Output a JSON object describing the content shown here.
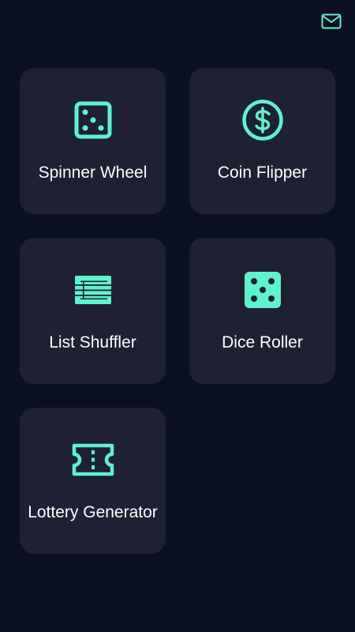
{
  "header": {
    "mail_icon": "mail-icon"
  },
  "colors": {
    "background": "#0b1120",
    "card": "#1d2133",
    "accent": "#5ef2cf",
    "text": "#ffffff"
  },
  "tools": [
    {
      "label": "Spinner Wheel",
      "icon": "dice-outline-icon"
    },
    {
      "label": "Coin Flipper",
      "icon": "dollar-coin-icon"
    },
    {
      "label": "List Shuffler",
      "icon": "list-icon"
    },
    {
      "label": "Dice Roller",
      "icon": "dice-solid-icon"
    },
    {
      "label": "Lottery Generator",
      "icon": "ticket-icon"
    }
  ]
}
